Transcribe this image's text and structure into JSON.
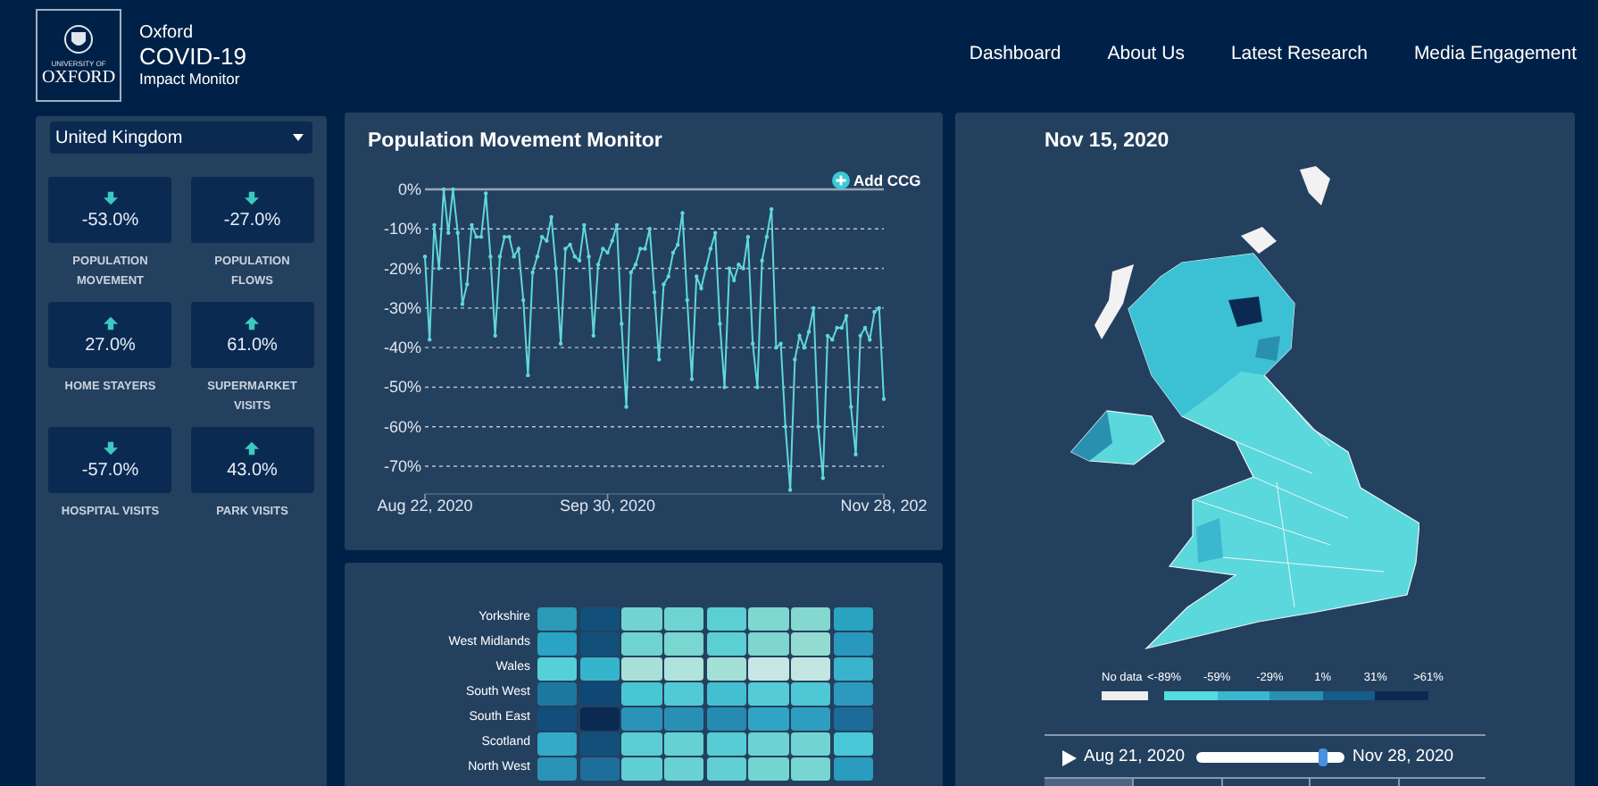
{
  "header": {
    "logo": {
      "line_1": "UNIVERSITY OF",
      "line_2": "OXFORD"
    },
    "brand": {
      "top": "Oxford",
      "title": "COVID-19",
      "subtitle": "Impact Monitor"
    },
    "nav": [
      {
        "label": "Dashboard"
      },
      {
        "label": "About Us"
      },
      {
        "label": "Latest Research"
      },
      {
        "label": "Media Engagement"
      }
    ]
  },
  "metrics_panel": {
    "region_select": {
      "value": "United Kingdom"
    },
    "metrics": [
      {
        "value": "-53.0%",
        "label": "POPULATION MOVEMENT",
        "kind": "down"
      },
      {
        "value": "-27.0%",
        "label": "POPULATION FLOWS",
        "kind": "down"
      },
      {
        "value": "27.0%",
        "label": "HOME STAYERS",
        "kind": "up"
      },
      {
        "value": "61.0%",
        "label": "SUPERMARKET VISITS",
        "kind": "up"
      },
      {
        "value": "-57.0%",
        "label": "HOSPITAL VISITS",
        "kind": "down"
      },
      {
        "value": "43.0%",
        "label": "PARK VISITS",
        "kind": "up"
      }
    ]
  },
  "movement_chart": {
    "title": "Population Movement Monitor",
    "add_button": "Add CCG",
    "chart_data": {
      "type": "line",
      "grid": true,
      "ylim": [
        -77,
        0
      ],
      "categories": [
        "Aug 22, 2020",
        null,
        null,
        null,
        null,
        null,
        null,
        null,
        null,
        null,
        null,
        null,
        null,
        null,
        null,
        null,
        null,
        null,
        null,
        null,
        null,
        null,
        null,
        null,
        null,
        null,
        null,
        null,
        null,
        null,
        null,
        null,
        null,
        null,
        null,
        null,
        null,
        null,
        null,
        "Sep 30, 2020",
        null,
        null,
        null,
        null,
        null,
        null,
        null,
        null,
        null,
        null,
        null,
        null,
        null,
        null,
        null,
        null,
        null,
        null,
        null,
        null,
        null,
        null,
        null,
        null,
        null,
        null,
        null,
        null,
        null,
        null,
        null,
        null,
        null,
        null,
        null,
        null,
        null,
        null,
        null,
        null,
        null,
        null,
        null,
        null,
        null,
        null,
        null,
        null,
        null,
        null,
        null,
        null,
        null,
        null,
        null,
        null,
        null,
        null,
        "Nov 28, 202"
      ],
      "yticks": [
        {
          "value": 0,
          "label": "0%"
        },
        {
          "value": -10,
          "label": "-10%"
        },
        {
          "value": -20,
          "label": "-20%"
        },
        {
          "value": -30,
          "label": "-30%"
        },
        {
          "value": -40,
          "label": "-40%"
        },
        {
          "value": -50,
          "label": "-50%"
        },
        {
          "value": -60,
          "label": "-60%"
        },
        {
          "value": -70,
          "label": "-70%"
        }
      ],
      "series": [
        {
          "color": "#5fd8dc",
          "values": [
            -17,
            -38,
            -9,
            -20,
            0,
            -11,
            0,
            -11,
            -29,
            -24,
            -9,
            -12,
            -12,
            -1,
            -17,
            -37,
            -17,
            -12,
            -12,
            -17,
            -15,
            -28,
            -47,
            -21,
            -17,
            -12,
            -13,
            -7,
            -20,
            -39,
            -15,
            -14,
            -17,
            -18,
            -9,
            -17,
            -37,
            -19,
            -15,
            -16,
            -13,
            -9,
            -34,
            -55,
            -21,
            -19,
            -15,
            -15,
            -10,
            -26,
            -43,
            -24,
            -22,
            -16,
            -14,
            -6,
            -28,
            -48,
            -22,
            -25,
            -20,
            -15,
            -11,
            -34,
            -50,
            -20,
            -23,
            -19,
            -20,
            -12,
            -39,
            -50,
            -18,
            -12,
            -5,
            -40,
            -39,
            -60,
            -76,
            -43,
            -37,
            -40,
            -36,
            -30,
            -60,
            -73,
            -37,
            -38,
            -35,
            -35,
            -32,
            -55,
            -67,
            -37,
            -35,
            -38,
            -31,
            -30,
            -53
          ]
        }
      ]
    }
  },
  "heatmap": {
    "rows": [
      {
        "label": "Yorkshire",
        "cells": [
          {
            "color": "#2a9ab8"
          },
          {
            "color": "#12507a"
          },
          {
            "color": "#72d4d0"
          },
          {
            "color": "#6fd3d2"
          },
          {
            "color": "#5ccfd2"
          },
          {
            "color": "#80d7cf"
          },
          {
            "color": "#84d8d0"
          },
          {
            "color": "#2aa3c0"
          }
        ]
      },
      {
        "label": "West Midlands",
        "cells": [
          {
            "color": "#2aa3c4"
          },
          {
            "color": "#12507a"
          },
          {
            "color": "#6fd3d0"
          },
          {
            "color": "#7ad6d0"
          },
          {
            "color": "#5ccfd2"
          },
          {
            "color": "#7ed6cf"
          },
          {
            "color": "#94dcd2"
          },
          {
            "color": "#2a98bc"
          }
        ]
      },
      {
        "label": "Wales",
        "cells": [
          {
            "color": "#55d0d8"
          },
          {
            "color": "#35b5cc"
          },
          {
            "color": "#a8e0d8"
          },
          {
            "color": "#b0e3dc"
          },
          {
            "color": "#a4e0d6"
          },
          {
            "color": "#c8e6e4"
          },
          {
            "color": "#c4e6e2"
          },
          {
            "color": "#3ab3cc"
          }
        ]
      },
      {
        "label": "South West",
        "cells": [
          {
            "color": "#1d78a0"
          },
          {
            "color": "#0f4775"
          },
          {
            "color": "#48c6d4"
          },
          {
            "color": "#52cad6"
          },
          {
            "color": "#44bfd0"
          },
          {
            "color": "#56cbd6"
          },
          {
            "color": "#4ec8d4"
          },
          {
            "color": "#2d99bd"
          }
        ]
      },
      {
        "label": "South East",
        "cells": [
          {
            "color": "#134d7a"
          },
          {
            "color": "#0a2a52"
          },
          {
            "color": "#2b93b8"
          },
          {
            "color": "#2a8fb5"
          },
          {
            "color": "#278ab0"
          },
          {
            "color": "#30a4c4"
          },
          {
            "color": "#2e9ec0"
          },
          {
            "color": "#1c6b98"
          }
        ]
      },
      {
        "label": "Scotland",
        "cells": [
          {
            "color": "#33aac8"
          },
          {
            "color": "#12507a"
          },
          {
            "color": "#5ccdd4"
          },
          {
            "color": "#66d1d3"
          },
          {
            "color": "#58ccd4"
          },
          {
            "color": "#6ed2d2"
          },
          {
            "color": "#72d4d2"
          },
          {
            "color": "#48c8d6"
          }
        ]
      },
      {
        "label": "North West",
        "cells": [
          {
            "color": "#2a93b8"
          },
          {
            "color": "#1d6e9a"
          },
          {
            "color": "#60cfd4"
          },
          {
            "color": "#6ad1d3"
          },
          {
            "color": "#62cfd4"
          },
          {
            "color": "#74d4d2"
          },
          {
            "color": "#78d6d2"
          },
          {
            "color": "#2a9cc0"
          }
        ]
      }
    ]
  },
  "map_panel": {
    "date": "Nov 15, 2020",
    "legend": {
      "no_data": {
        "label": "No data",
        "color": "#eeeeee"
      },
      "bins": [
        {
          "color": "#55dce0"
        },
        {
          "color": "#3bb8d0"
        },
        {
          "color": "#2a90b0"
        },
        {
          "color": "#155d8a"
        },
        {
          "color": "#0a2a52"
        }
      ],
      "thresholds": [
        "<-89%",
        "-59%",
        "-29%",
        "1%",
        "31%",
        ">61%"
      ]
    },
    "timeline": {
      "start": "Aug 21, 2020",
      "end": "Nov 28, 2020",
      "level": 0.86
    },
    "tabs": [
      {
        "selected": true
      },
      {
        "selected": false
      },
      {
        "selected": false
      },
      {
        "selected": false
      },
      {
        "selected": false
      }
    ]
  }
}
